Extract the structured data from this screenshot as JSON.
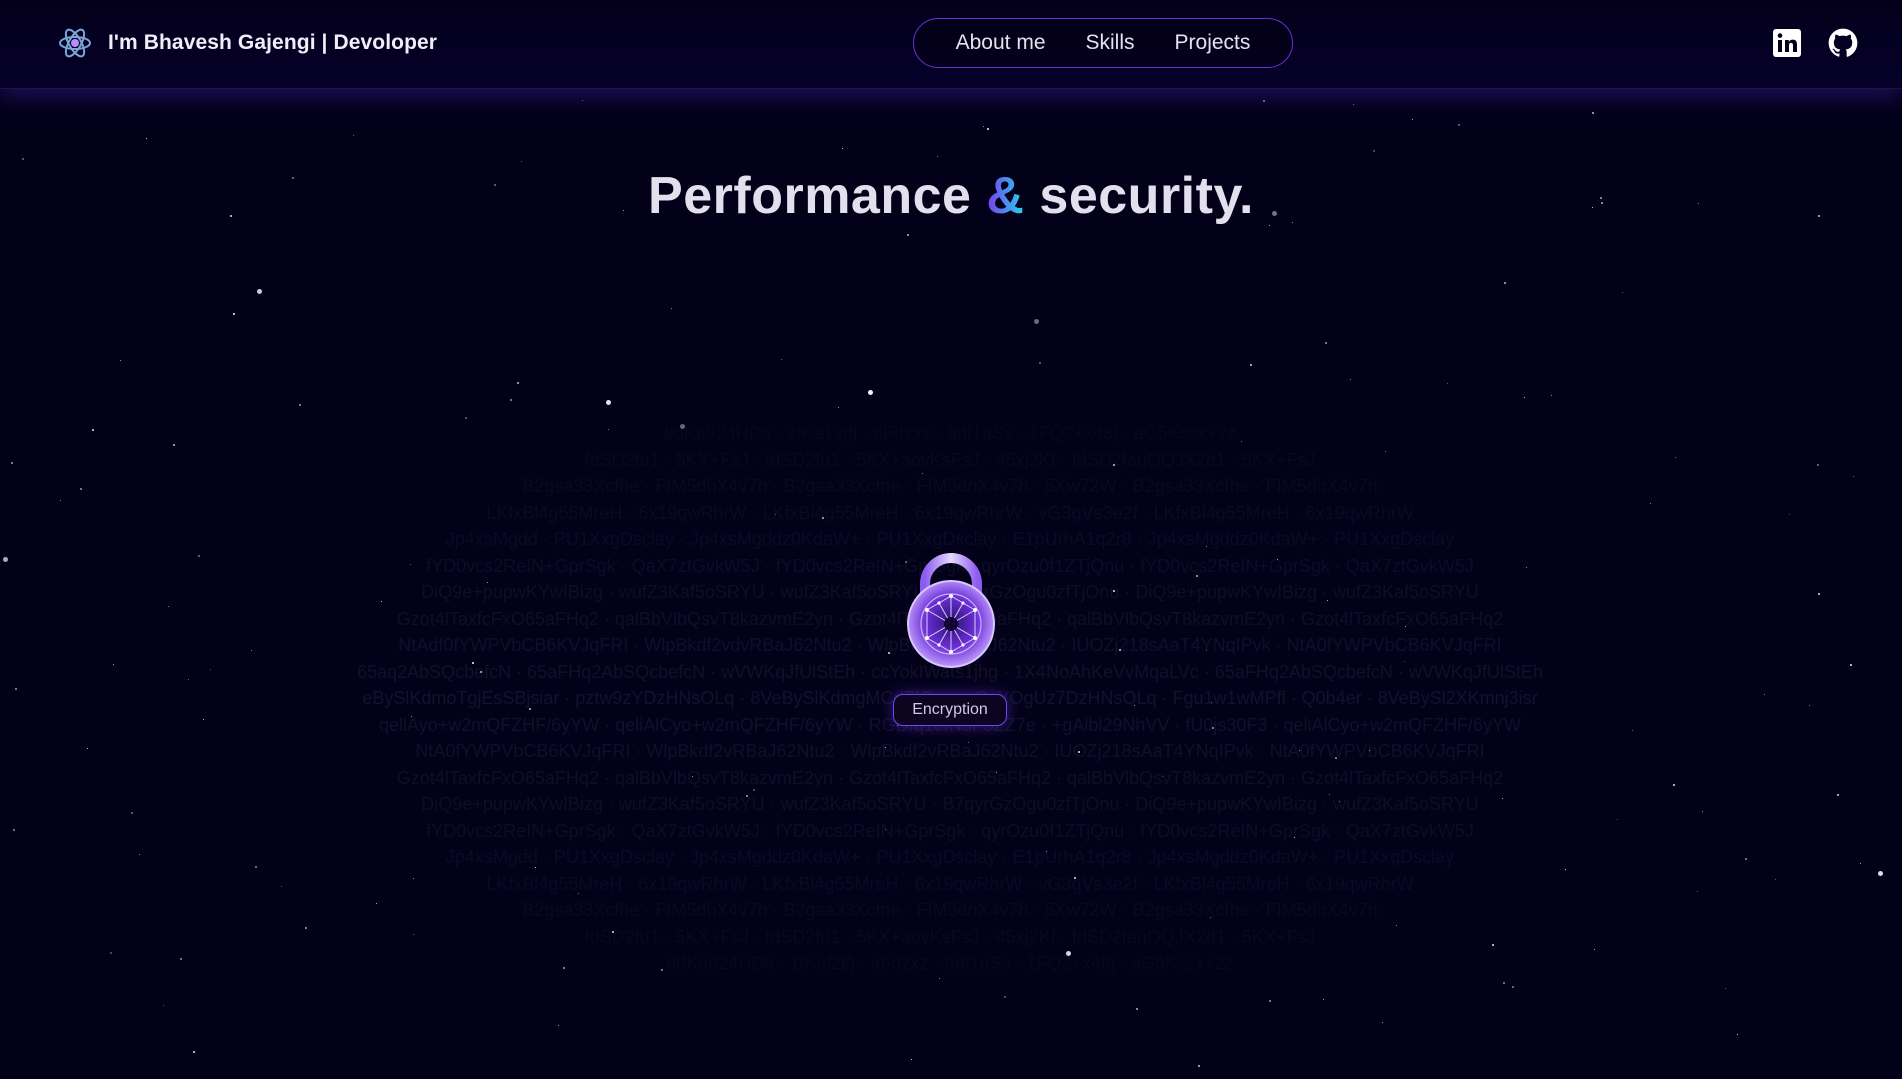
{
  "header": {
    "brand_text": "I'm Bhavesh Gajengi | Devoloper",
    "brand_icon": "atom-logo-icon",
    "nav_links": [
      "About me",
      "Skills",
      "Projects"
    ],
    "social_icons": [
      "linkedin-icon",
      "github-icon"
    ]
  },
  "hero": {
    "title_part1": "Performance",
    "title_amp": "&",
    "title_part2": "security."
  },
  "encryption": {
    "label": "Encryption",
    "cipher_lines": [
      "8dKa824HDs · 1fKa12jfj · aFdzxz · 8df1uSs · 1FQ2+x48j · aG5Kszx+2z",
      "fdSD2fu1 · 5KX+FsJ · fdSD2fu1 · 5KX+aovKsFsJ · 45xj2Kf · fdSD2fauOQJX2d1 · 5KX+FsJ",
      "B2gsa33Xcfhe · FIM5dhX4v7h · B2gsa33Xcfhe · FIM5dhX4v7h · 5Xw72W · B2gsa33Xcfhe · FIM5dhX4v7h",
      "LKfxBl4g55MreH · 6x19qwRhrW · LKfxBl4g55MreH · 6x19qwRhrW · vG3gVs3e2f · LKfxBl4g55MreH · 6x19qwRhrW",
      "Jp4xsMgdd · PU1XxgDsclay · Jp4xsMgddz0KdaW+ · PU1XxgDsclay · E1pUrhA1q2r8 · Jp4xsMgddz0KdaW+ · PU1XxgDsclay",
      "fYD0vcs2ReIN+GprSgk · QaX7ztGvkW5J · fYD0vcs2ReIN+GprSgk · qyrOzu0f1ZTjQnu · fYD0vcs2ReIN+GprSgk · QaX7ztGvkW5J",
      "DiQ9e+pupwKYwIBizg · wufZ3Kaf5oSRYU · wufZ3Kaf5oSRYU · B7qyrGzOgu0zfTjOnu · DiQ9e+pupwKYwIBizg · wufZ3Kaf5oSRYU",
      "Gzot4lTaxfcFxO65aFHq2 · qalBbVlbQsvT8kazvmE2yn · Gzot4lTaxfcFxO65aFHq2 · qalBbVlbQsvT8kazvmE2yn · Gzot4lTaxfcFxO65aFHq2",
      "NtAdf0fYWPVbCB6KVJqFRI · WlpBkdf2vdvRBaJ62Ntu2 · WlpBkdf2vRBaJ62Ntu2 · IUOZj218sAaT4YNqIPvk · NtA0fYWPVbCB6KVJqFRI",
      "65aq2AbSQcbefcN · 65aFHq2AbSQcbefcN · wVWKqJfUlStEh · ccYokIWats1jhg · 1X4NoAhKeVvMqaLVc · 65aFHq2AbSQcbefcN · wVWKqJfUlStEh",
      "eBySlKdmoTgjEsSBjsiar · pztw9zYDzHNsOLq · 8VeBySlKdmgMCdTfQ · qyrOzYOgUz7DzHNsOLq · Fgu1w1wMPfl · Q0b4er · 8VeBySl2XKmnj3isr",
      "qeliAyo+w2mQFZHF/6yYW · qeliAlCyo+w2mQFZHF/6yYW · RGDIq1efNdP5ZZ7e · +gAlbl29NhVV · fU0js30F3 · qeliAlCyo+w2mQFZHF/6yYW",
      "NtA0fYWPVbCB6KVJqFRI · WlpBkdf2vRBaJ62Ntu2 · WlpBkdf2vRBaJ62Ntu2 · IUOZj218sAaT4YNqIPvk · NtA0fYWPVbCB6KVJqFRI",
      "Gzot4lTaxfcFxO65aFHq2 · qalBbVlbQsvT8kazvmE2yn · Gzot4lTaxfcFxO65aFHq2 · qalBbVlbQsvT8kazvmE2yn · Gzot4lTaxfcFxO65aFHq2",
      "DiQ9e+pupwKYwIBizg · wufZ3Kaf5oSRYU · wufZ3Kaf5oSRYU · B7qyrGzOgu0zfTjOnu · DiQ9e+pupwKYwIBizg · wufZ3Kaf5oSRYU",
      "fYD0vcs2ReIN+GprSgk · QaX7ztGvkW5J · fYD0vcs2ReIN+GprSgk · qyrOzu0f1ZTjQnu · fYD0vcs2ReIN+GprSgk · QaX7ztGvkW5J",
      "Jp4xsMgdd · PU1XxgDsclay · Jp4xsMgddz0KdaW+ · PU1XxgDsclay · E1pUrhA1q2r8 · Jp4xsMgddz0KdaW+ · PU1XxgDsclay",
      "LKfxBl4g55MreH · 6x19qwRhrW · LKfxBl4g55MreH · 6x19qwRhrW · vG3gVs3e2f · LKfxBl4g55MreH · 6x19qwRhrW",
      "B2gsa33Xcfhe · FIM5dhX4v7h · B2gsa33Xcfhe · FIM5dhX4v7h · 5Xw72W · B2gsa33Xcfhe · FIM5dhX4v7h",
      "fdSD2fu1 · 5KX+FsJ · fdSD2fu1 · 5KX+aovKsFsJ · 45xj2Kf · fdSD2fauOQJX2d1 · 5KX+FsJ",
      "8dKa824HDs · 1fKaf2jfj · aFdzxz · 8df1uSs · 1FQ2+x48j · aG5Kszx+2z"
    ]
  }
}
